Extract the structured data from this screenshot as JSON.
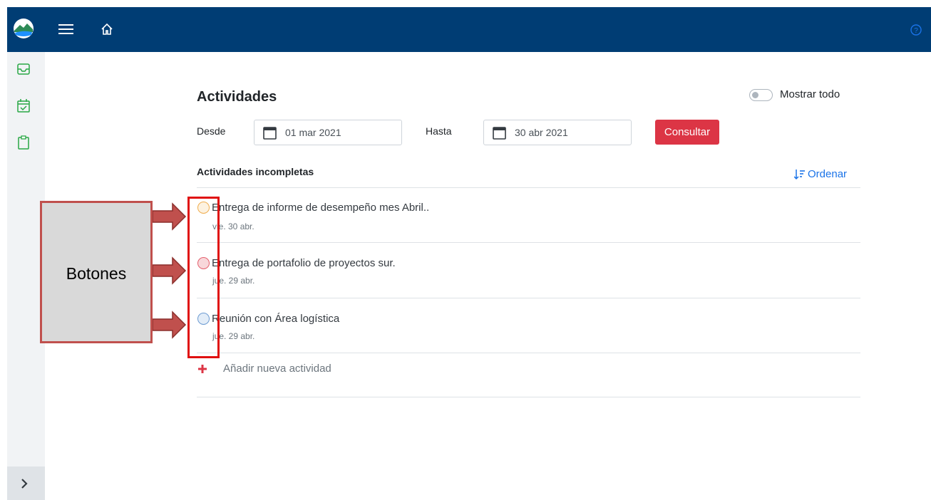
{
  "header": {
    "menu_icon": "hamburger-icon",
    "home_icon": "home-icon",
    "help_icon": "help-icon",
    "logo_icon": "mountain-logo-icon"
  },
  "sidebar": {
    "items": [
      {
        "icon": "inbox-icon"
      },
      {
        "icon": "calendar-check-icon"
      },
      {
        "icon": "clipboard-icon"
      }
    ],
    "expand_icon": "chevron-right-icon"
  },
  "main": {
    "title": "Actividades",
    "show_all_label": "Mostrar todo",
    "from_label": "Desde",
    "from_value": "01 mar 2021",
    "to_label": "Hasta",
    "to_value": "30 abr 2021",
    "query_button": "Consultar",
    "section_title": "Actividades incompletas",
    "sort_label": "Ordenar",
    "tasks": [
      {
        "title": "Entrega de informe de desempeño mes Abril..",
        "date": "vie. 30 abr.",
        "color": "#f0ad4e"
      },
      {
        "title": "Entrega de portafolio de proyectos sur.",
        "date": "jue. 29 abr.",
        "color": "#e4606d"
      },
      {
        "title": "Reunión con Área logística",
        "date": "jue. 29 abr.",
        "color": "#6c9bd2"
      }
    ],
    "add_label": "Añadir nueva actividad"
  },
  "annotation": {
    "label": "Botones"
  },
  "colors": {
    "header": "#003d74",
    "accent": "#dc3545",
    "link": "#1a73e8",
    "sidebar_icon": "#28a745"
  }
}
